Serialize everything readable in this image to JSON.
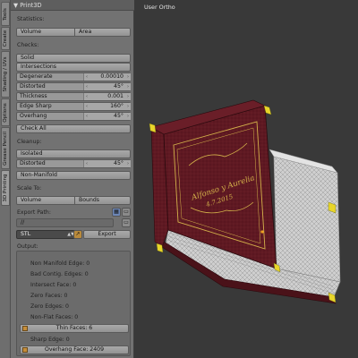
{
  "tabs": [
    "Tools",
    "Create",
    "Shading / UVs",
    "Options",
    "Grease Pencil",
    "3D Printing"
  ],
  "panel": {
    "title": "Print3D",
    "statistics_label": "Statistics:",
    "volume_btn": "Volume",
    "area_btn": "Area",
    "checks_label": "Checks:",
    "solid_btn": "Solid",
    "intersections_btn": "Intersections",
    "degenerate": {
      "label": "Degenerate",
      "value": "0.00010"
    },
    "distorted": {
      "label": "Distorted",
      "value": "45°"
    },
    "thickness": {
      "label": "Thickness",
      "value": "0.001"
    },
    "edge_sharp": {
      "label": "Edge Sharp",
      "value": "160°"
    },
    "overhang": {
      "label": "Overhang",
      "value": "45°"
    },
    "check_all_btn": "Check All",
    "cleanup_label": "Cleanup:",
    "isolated_btn": "Isolated",
    "distorted2": {
      "label": "Distorted",
      "value": "45°"
    },
    "non_manifold_btn": "Non-Manifold",
    "scale_to_label": "Scale To:",
    "scale_volume_btn": "Volume",
    "bounds_btn": "Bounds",
    "export_path_label": "Export Path:",
    "export_path_value": "//",
    "format_value": "STL",
    "export_btn": "Export",
    "output_label": "Output:",
    "output": {
      "non_manifold": "Non Manifold Edge: 0",
      "bad_contig": "Bad Contig. Edges: 0",
      "intersect": "Intersect Face: 0",
      "zero_faces": "Zero Faces: 0",
      "zero_edges": "Zero Edges: 0",
      "non_flat": "Non-Flat Faces: 0",
      "thin_faces": "Thin Faces: 6",
      "sharp_edge": "Sharp Edge: 0",
      "overhang_face": "Overhang Face: 2409"
    }
  },
  "viewport": {
    "view_label": "User Ortho",
    "cover_text_1": "Alfonso y Aurelia",
    "cover_text_2": "4.7.2015"
  },
  "colors": {
    "cover": "#5a1620",
    "gold": "#d4b24a",
    "pages": "#d8d8d8",
    "highlight": "#e8d52a"
  }
}
